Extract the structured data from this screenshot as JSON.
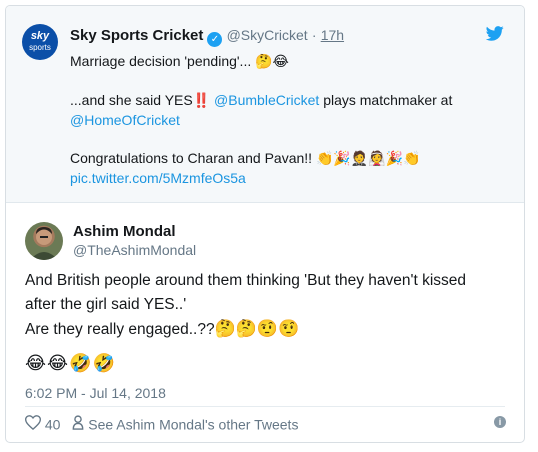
{
  "quoted": {
    "avatar_line1": "sky",
    "avatar_line2": "sports",
    "name": "Sky Sports Cricket",
    "handle": "@SkyCricket",
    "separator": "·",
    "time": "17h",
    "line1": "Marriage decision 'pending'...",
    "line1_emoji": "🤔😂",
    "line2a": "...and she said YES",
    "line2_emoji": "‼️",
    "mention1": "@BumbleCricket",
    "line2b": "plays matchmaker at",
    "mention2": "@HomeOfCricket",
    "line3": "Congratulations to Charan and Pavan!!",
    "line3_emoji": "👏🎉🤵👰🎉👏",
    "link": "pic.twitter.com/5MzmfeOs5a"
  },
  "tweet": {
    "name": "Ashim Mondal",
    "handle": "@TheAshimMondal",
    "text_line1": "And British people around them thinking 'But they haven't kissed",
    "text_line2": "after the girl said YES..'",
    "text_line3": "Are they really engaged..??",
    "text_line3_emoji": "🤔🤔🤨🤨",
    "emoji_line": "😂😂🤣🤣",
    "timestamp": "6:02 PM - Jul 14, 2018",
    "likes": "40",
    "other_tweets": "See Ashim Mondal's other Tweets"
  },
  "icons": {
    "verified": "verified-badge-icon",
    "bird": "twitter-bird-icon",
    "heart": "heart-icon",
    "person": "person-icon",
    "info": "info-icon"
  },
  "colors": {
    "link": "#1b95e0",
    "twitter_blue": "#1da1f2",
    "muted": "#657786"
  }
}
